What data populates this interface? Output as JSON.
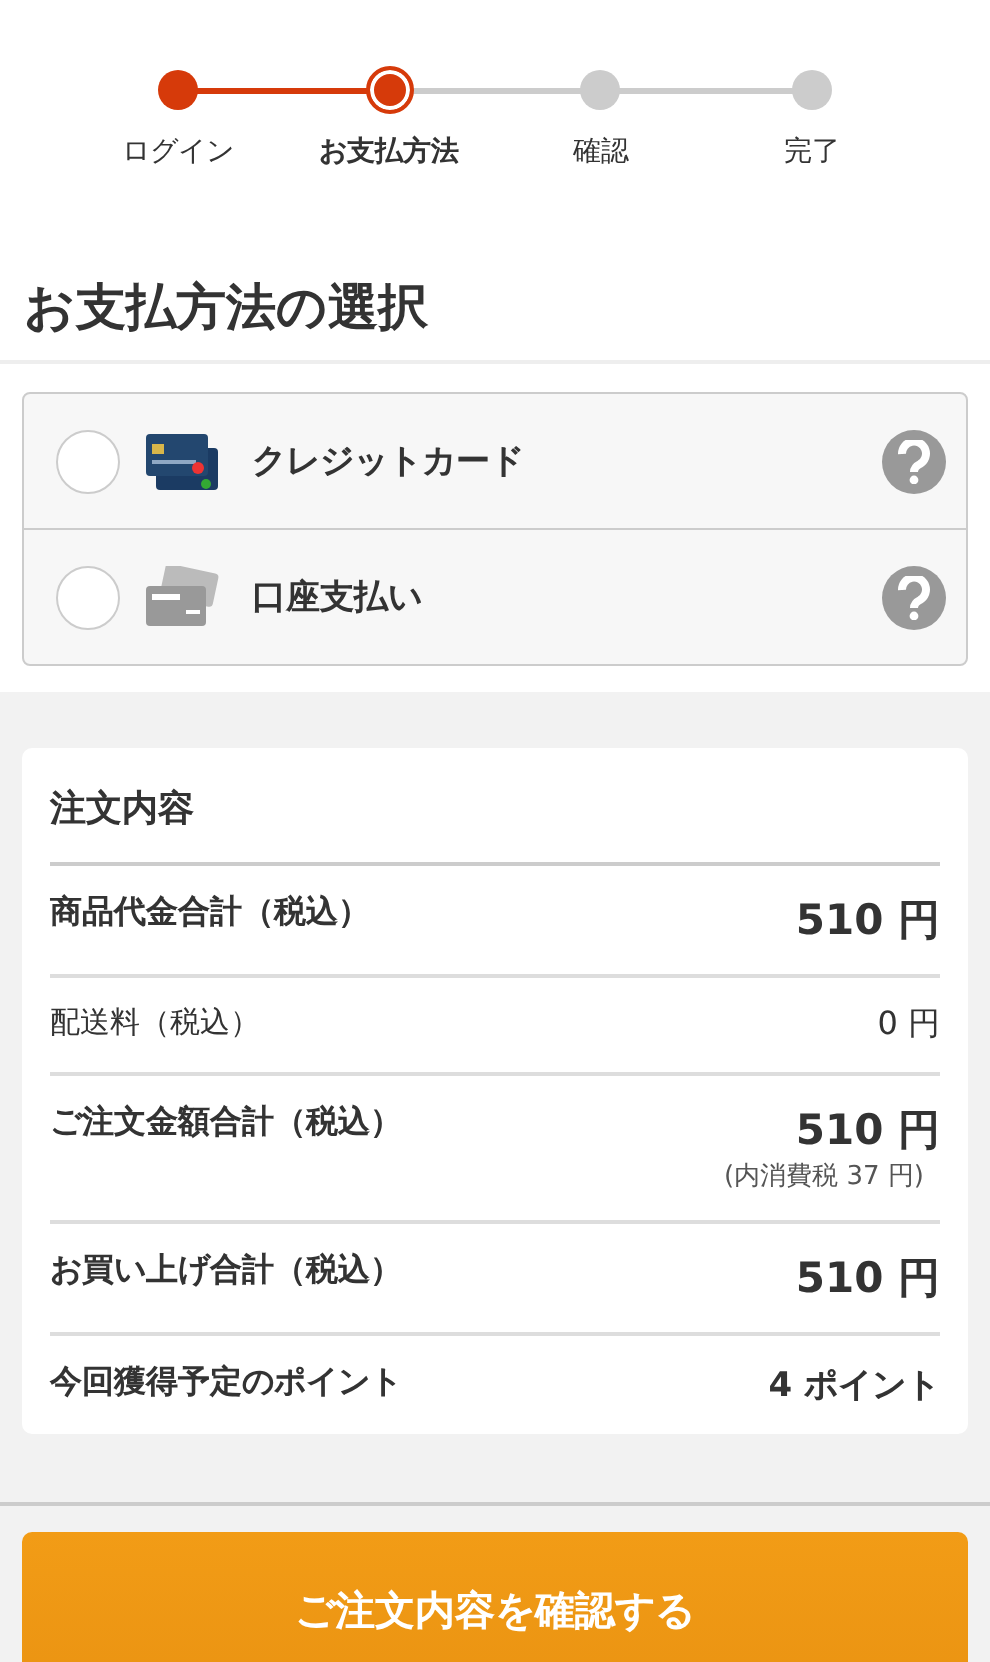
{
  "steps": [
    {
      "label": "ログイン",
      "completed": true,
      "selected": false
    },
    {
      "label": "お支払方法",
      "completed": false,
      "selected": true
    },
    {
      "label": "確認",
      "completed": false,
      "selected": false
    },
    {
      "label": "完了",
      "completed": false,
      "selected": false
    }
  ],
  "heading": "お支払方法の選択",
  "payment_options": [
    {
      "label": "クレジットカード",
      "selected": false,
      "kind": "credit"
    },
    {
      "label": "口座支払い",
      "selected": false,
      "kind": "account"
    }
  ],
  "order": {
    "title": "注文内容",
    "rows": [
      {
        "label": "商品代金合計（税込）",
        "value": "510 円",
        "kind": "total"
      },
      {
        "label": "配送料（税込）",
        "value": "0 円",
        "kind": "plain"
      },
      {
        "label": "ご注文金額合計（税込）",
        "value": "510 円",
        "note": "(内消費税 37 円)",
        "kind": "total"
      },
      {
        "label": "お買い上げ合計（税込）",
        "value": "510 円",
        "kind": "total"
      },
      {
        "label": "今回獲得予定のポイント",
        "value": "4 ポイント",
        "kind": "points"
      }
    ]
  },
  "confirm_button": "ご注文内容を確認する"
}
